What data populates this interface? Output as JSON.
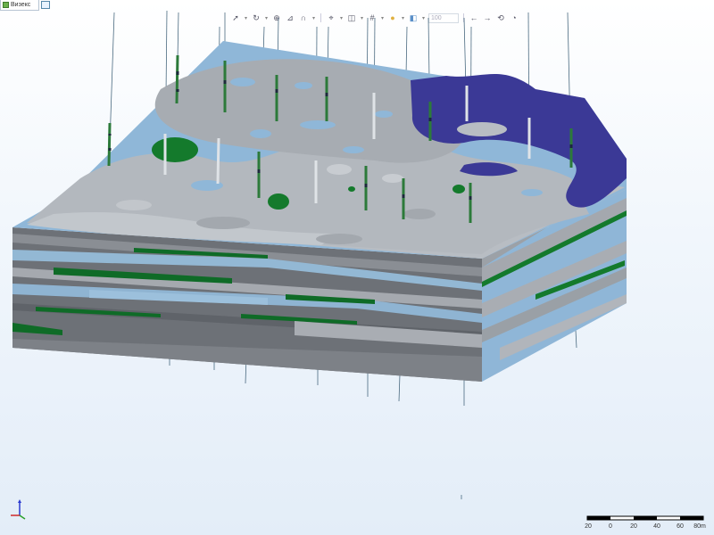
{
  "window": {
    "tab_label": "Визекс",
    "tab_icon": "layers-icon",
    "new_window_icon": "new-window-icon"
  },
  "toolbar": {
    "zoom_value": "100",
    "tools": [
      "select-arrow-icon",
      "rotate-icon",
      "zoom-icon",
      "measure-icon",
      "magnet-icon",
      "target-icon",
      "layers-icon",
      "grid-icon",
      "light-icon",
      "sections-icon",
      "back-icon",
      "forward-icon",
      "view-icon",
      "settings-icon"
    ]
  },
  "scene": {
    "description_colors": {
      "light_gray": "#b8bdc3",
      "mid_gray": "#a3a8ae",
      "light_blue": "#8fb7d8",
      "dark_blue": "#3c3b96",
      "green": "#147a2c",
      "side_dark": "#6a6e75"
    }
  },
  "axis_indicator": {
    "labels": [
      "Z",
      "X",
      "Y"
    ]
  },
  "scalebar": {
    "labels": [
      "20",
      "0",
      "20",
      "40",
      "60",
      "80m"
    ]
  }
}
